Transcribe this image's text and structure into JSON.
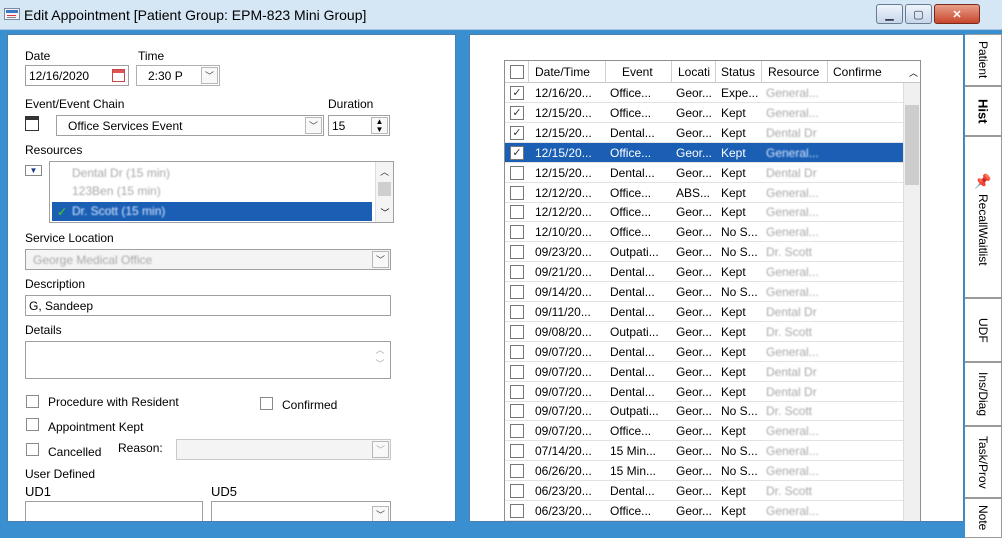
{
  "window": {
    "title": "Edit Appointment [Patient Group: EPM-823 Mini Group]"
  },
  "form": {
    "date_label": "Date",
    "date_value": "12/16/2020",
    "time_label": "Time",
    "time_value": "2:30 P",
    "event_chain_label": "Event/Event Chain",
    "event_value": "Office Services Event",
    "duration_label": "Duration",
    "duration_value": "15",
    "resources_label": "Resources",
    "resources": [
      "Dental Dr (15 min)",
      "123Ben (15 min)",
      "Dr. Scott (15 min)"
    ],
    "service_location_label": "Service Location",
    "service_location_value": "George Medical Office",
    "description_label": "Description",
    "description_value": "G, Sandeep",
    "details_label": "Details",
    "details_value": "",
    "procedure_label": "Procedure with Resident",
    "confirmed_label": "Confirmed",
    "appointment_kept_label": "Appointment Kept",
    "cancelled_label": "Cancelled",
    "reason_label": "Reason:",
    "user_defined_label": "User Defined",
    "ud1_label": "UD1",
    "ud5_label": "UD5"
  },
  "grid": {
    "columns": [
      "Date/Time",
      "Event",
      "Locati",
      "Status",
      "Resource",
      "Confirme"
    ],
    "rows": [
      {
        "checked": true,
        "date": "12/16/20...",
        "event": "Office...",
        "location": "Geor...",
        "status": "Expe...",
        "resource": "General...",
        "selected": false
      },
      {
        "checked": true,
        "date": "12/15/20...",
        "event": "Office...",
        "location": "Geor...",
        "status": "Kept",
        "resource": "General...",
        "selected": false
      },
      {
        "checked": true,
        "date": "12/15/20...",
        "event": "Dental...",
        "location": "Geor...",
        "status": "Kept",
        "resource": "Dental Dr",
        "selected": false
      },
      {
        "checked": true,
        "date": "12/15/20...",
        "event": "Office...",
        "location": "Geor...",
        "status": "Kept",
        "resource": "General...",
        "selected": true
      },
      {
        "checked": false,
        "date": "12/15/20...",
        "event": "Dental...",
        "location": "Geor...",
        "status": "Kept",
        "resource": "Dental Dr",
        "selected": false
      },
      {
        "checked": false,
        "date": "12/12/20...",
        "event": "Office...",
        "location": "ABS...",
        "status": "Kept",
        "resource": "General...",
        "selected": false
      },
      {
        "checked": false,
        "date": "12/12/20...",
        "event": "Office...",
        "location": "Geor...",
        "status": "Kept",
        "resource": "General...",
        "selected": false
      },
      {
        "checked": false,
        "date": "12/10/20...",
        "event": "Office...",
        "location": "Geor...",
        "status": "No S...",
        "resource": "General...",
        "selected": false
      },
      {
        "checked": false,
        "date": "09/23/20...",
        "event": "Outpati...",
        "location": "Geor...",
        "status": "No S...",
        "resource": "Dr. Scott",
        "selected": false
      },
      {
        "checked": false,
        "date": "09/21/20...",
        "event": "Dental...",
        "location": "Geor...",
        "status": "Kept",
        "resource": "General...",
        "selected": false
      },
      {
        "checked": false,
        "date": "09/14/20...",
        "event": "Dental...",
        "location": "Geor...",
        "status": "No S...",
        "resource": "General...",
        "selected": false
      },
      {
        "checked": false,
        "date": "09/11/20...",
        "event": "Dental...",
        "location": "Geor...",
        "status": "Kept",
        "resource": "Dental Dr",
        "selected": false
      },
      {
        "checked": false,
        "date": "09/08/20...",
        "event": "Outpati...",
        "location": "Geor...",
        "status": "Kept",
        "resource": "Dr. Scott",
        "selected": false
      },
      {
        "checked": false,
        "date": "09/07/20...",
        "event": "Dental...",
        "location": "Geor...",
        "status": "Kept",
        "resource": "General...",
        "selected": false
      },
      {
        "checked": false,
        "date": "09/07/20...",
        "event": "Dental...",
        "location": "Geor...",
        "status": "Kept",
        "resource": "Dental Dr",
        "selected": false
      },
      {
        "checked": false,
        "date": "09/07/20...",
        "event": "Dental...",
        "location": "Geor...",
        "status": "Kept",
        "resource": "Dental Dr",
        "selected": false
      },
      {
        "checked": false,
        "date": "09/07/20...",
        "event": "Outpati...",
        "location": "Geor...",
        "status": "No S...",
        "resource": "Dr. Scott",
        "selected": false
      },
      {
        "checked": false,
        "date": "09/07/20...",
        "event": "Office...",
        "location": "Geor...",
        "status": "Kept",
        "resource": "General...",
        "selected": false
      },
      {
        "checked": false,
        "date": "07/14/20...",
        "event": "15 Min...",
        "location": "Geor...",
        "status": "No S...",
        "resource": "General...",
        "selected": false
      },
      {
        "checked": false,
        "date": "06/26/20...",
        "event": "15 Min...",
        "location": "Geor...",
        "status": "No S...",
        "resource": "General...",
        "selected": false
      },
      {
        "checked": false,
        "date": "06/23/20...",
        "event": "Dental...",
        "location": "Geor...",
        "status": "Kept",
        "resource": "Dr. Scott",
        "selected": false
      },
      {
        "checked": false,
        "date": "06/23/20...",
        "event": "Office...",
        "location": "Geor...",
        "status": "Kept",
        "resource": "General...",
        "selected": false
      }
    ]
  },
  "tabs": [
    "Patient",
    "Hist",
    "RecallWaitlist",
    "UDF",
    "Ins/Diag",
    "Task/Prov",
    "Note"
  ],
  "active_tab": "Hist"
}
